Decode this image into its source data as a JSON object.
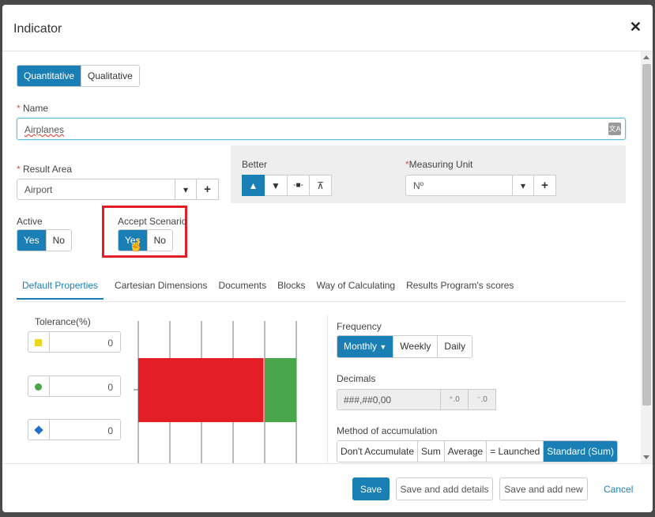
{
  "dialog": {
    "title": "Indicator",
    "close_icon": "close-icon"
  },
  "indicator_type": {
    "options": [
      "Quantitative",
      "Qualitative"
    ],
    "selected": "Quantitative"
  },
  "name": {
    "label": "Name",
    "value": "Airplanes",
    "icon": "translate-icon"
  },
  "result_area": {
    "label": "Result Area",
    "value": "Airport"
  },
  "better": {
    "label": "Better",
    "options": [
      "up-triangle-icon",
      "down-triangle-icon",
      "target-icon",
      "range-icon"
    ],
    "selected": "up-triangle-icon"
  },
  "measuring_unit": {
    "label": "Measuring Unit",
    "value": "Nº"
  },
  "active": {
    "label": "Active",
    "yes": "Yes",
    "no": "No",
    "selected": "Yes"
  },
  "accept_scenario": {
    "label": "Accept Scenario",
    "yes": "Yes",
    "no": "No",
    "selected": "Yes"
  },
  "tabs": [
    "Default Properties",
    "Cartesian Dimensions",
    "Documents",
    "Blocks",
    "Way of Calculating",
    "Results Program's scores"
  ],
  "active_tab": "Default Properties",
  "tolerance": {
    "label": "Tolerance(%)",
    "rows": [
      {
        "icon": "yellow-square-icon",
        "value": "0",
        "color": "#e8d820"
      },
      {
        "icon": "green-circle-icon",
        "value": "0",
        "color": "#4aa64a"
      },
      {
        "icon": "blue-diamond-icon",
        "value": "0",
        "color": "#1f6fc9"
      }
    ]
  },
  "tolerance_chart": {
    "red": "#e31e24",
    "green": "#4aa64a"
  },
  "frequency": {
    "label": "Frequency",
    "options": [
      "Monthly",
      "Weekly",
      "Daily"
    ],
    "selected": "Monthly"
  },
  "decimals": {
    "label": "Decimals",
    "value": "###,##0,00"
  },
  "accumulation": {
    "label": "Method of accumulation",
    "options": [
      "Don't Accumulate",
      "Sum",
      "Average",
      "= Launched",
      "Standard (Sum)"
    ],
    "selected": "Standard (Sum)"
  },
  "footer": {
    "save": "Save",
    "save_details": "Save and add details",
    "save_new": "Save and add new",
    "cancel": "Cancel"
  }
}
